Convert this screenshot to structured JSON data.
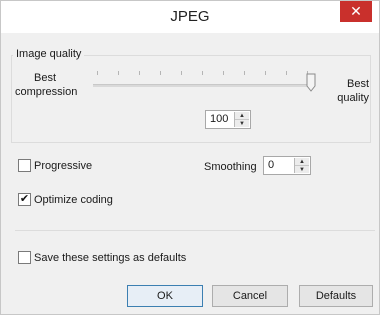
{
  "window": {
    "title": "JPEG",
    "close_glyph": "✕"
  },
  "image_quality": {
    "group_label": "Image quality",
    "left_label": "Best\ncompression",
    "right_label": "Best\nquality",
    "slider_value": 1.0,
    "quality_value": "100"
  },
  "options": {
    "progressive_label": "Progressive",
    "progressive_checked": false,
    "optimize_label": "Optimize coding",
    "optimize_checked": true,
    "smoothing_label": "Smoothing",
    "smoothing_value": "0",
    "save_defaults_label": "Save these settings as defaults",
    "save_defaults_checked": false
  },
  "buttons": {
    "ok": "OK",
    "cancel": "Cancel",
    "defaults": "Defaults"
  },
  "colors": {
    "close_bg": "#c9302c",
    "default_button_border": "#3c7fb1"
  }
}
